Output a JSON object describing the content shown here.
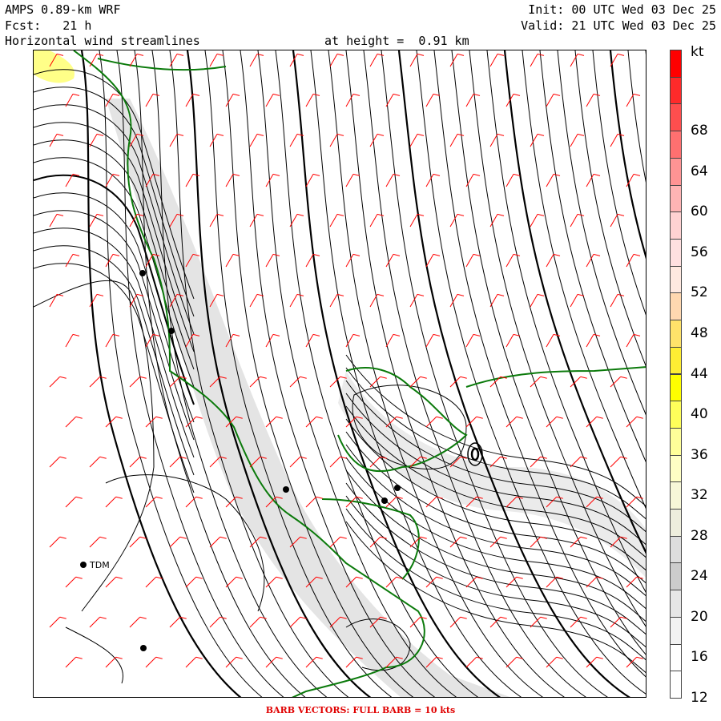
{
  "header": {
    "model": "AMPS 0.89-km WRF",
    "fcst_label": "Fcst:",
    "fcst_value": "21 h",
    "field": "Horizontal wind streamlines",
    "height_label": "at height =",
    "height_value": "0.91 km",
    "init": "Init: 00 UTC Wed 03 Dec 25",
    "valid": "Valid: 21 UTC Wed 03 Dec 25"
  },
  "colorbar": {
    "unit": "kt",
    "labels": [
      "68",
      "64",
      "60",
      "56",
      "52",
      "48",
      "44",
      "40",
      "36",
      "32",
      "28",
      "24",
      "20",
      "16",
      "12"
    ],
    "colors": [
      "#ff0000",
      "#ff2a2a",
      "#ff4e4e",
      "#ff7070",
      "#ff9494",
      "#ffb4b4",
      "#ffd2d2",
      "#ffe0e0",
      "#ffe9e0",
      "#ffd8b0",
      "#ffe36a",
      "#ffee33",
      "#ffff00",
      "#ffff5a",
      "#ffff99",
      "#ffffc4",
      "#f7f7d8",
      "#eeeedd",
      "#dddddd",
      "#cccccc",
      "#e6e6e6",
      "#f2f2f2",
      "#ffffff",
      "#ffffff"
    ]
  },
  "stations": [
    {
      "name": "TDM"
    }
  ],
  "footer": "BARB VECTORS:  FULL BARB = 10 kts",
  "colors": {
    "coastline": "#0b7a0b",
    "barbs": "#ff0000",
    "streamlines": "#000000"
  }
}
